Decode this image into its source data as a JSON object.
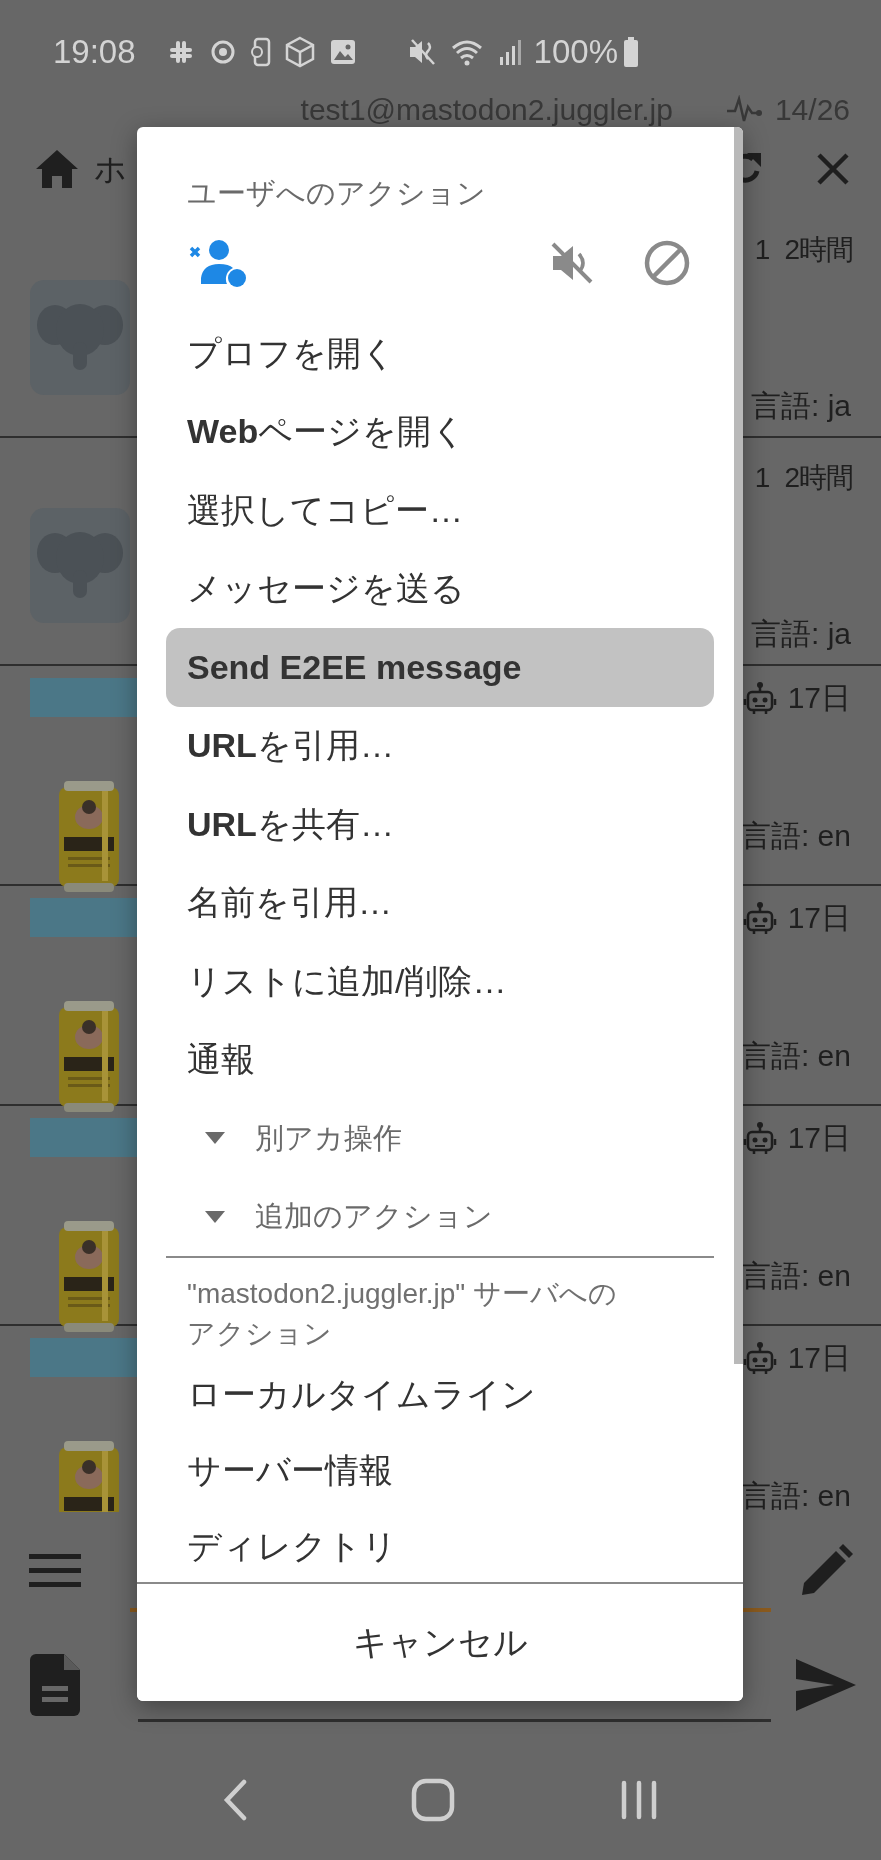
{
  "status_bar": {
    "time": "19:08",
    "battery": "100%"
  },
  "account": {
    "handle": "test1@mastodon2.juggler.jp",
    "counter": "14/26"
  },
  "column": {
    "title": "ホ"
  },
  "timeline": [
    {
      "kind": "user",
      "count": "1",
      "time": "2時間",
      "language": "言語: ja"
    },
    {
      "kind": "user",
      "count": "1",
      "time": "2時間",
      "language": "言語: ja"
    },
    {
      "kind": "bot",
      "time": "17日",
      "language": "言語: en"
    },
    {
      "kind": "bot",
      "time": "17日",
      "language": "言語: en"
    },
    {
      "kind": "bot",
      "time": "17日",
      "language": "言語: en"
    },
    {
      "kind": "bot",
      "time": "17日",
      "language": "言語: en"
    }
  ],
  "dialog": {
    "title": "ユーザへのアクション",
    "items": [
      {
        "kind": "action",
        "label": "プロフを開く",
        "selected": false
      },
      {
        "kind": "action",
        "label": "**Web**ページを開く",
        "selected": false
      },
      {
        "kind": "action",
        "label": "選択してコピー…",
        "selected": false
      },
      {
        "kind": "action",
        "label": "メッセージを送る",
        "selected": false
      },
      {
        "kind": "action",
        "label": "Send E2EE message",
        "selected": true,
        "bold": true
      },
      {
        "kind": "action",
        "label": "**URL**を引用…",
        "selected": false
      },
      {
        "kind": "action",
        "label": "**URL**を共有…",
        "selected": false
      },
      {
        "kind": "action",
        "label": "名前を引用…",
        "selected": false
      },
      {
        "kind": "action",
        "label": "リストに追加/削除…",
        "selected": false
      },
      {
        "kind": "action",
        "label": "通報",
        "selected": false
      },
      {
        "kind": "expander",
        "label": "別アカ操作",
        "expanded": false
      },
      {
        "kind": "expander",
        "label": "追加のアクション",
        "expanded": false
      },
      {
        "kind": "header",
        "label": "\"mastodon2.juggler.jp\" サーバへのアクション"
      },
      {
        "kind": "action",
        "label": "ローカルタイムライン",
        "selected": false
      },
      {
        "kind": "action",
        "label": "サーバー情報",
        "selected": false
      },
      {
        "kind": "action",
        "label": "ディレクトリ",
        "selected": false
      }
    ],
    "cancel": "キャンセル"
  }
}
